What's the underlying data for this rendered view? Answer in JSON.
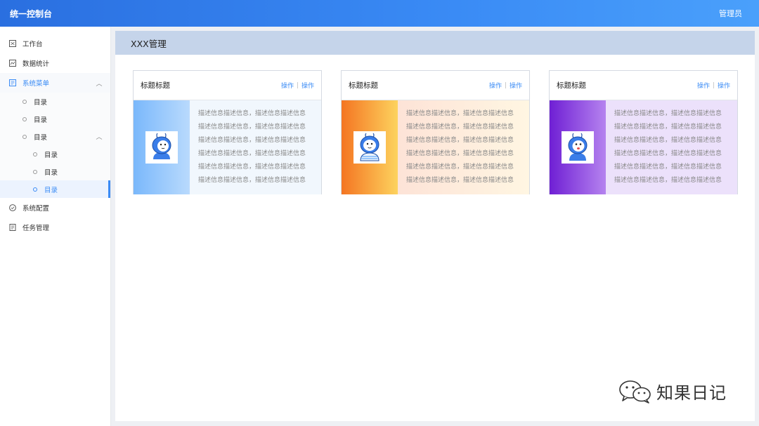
{
  "header": {
    "title": "统一控制台",
    "user": "管理员"
  },
  "sidebar": {
    "items": [
      {
        "label": "工作台",
        "icon": "workbench-icon"
      },
      {
        "label": "数据统计",
        "icon": "chart-icon"
      },
      {
        "label": "系统菜单",
        "icon": "menu-icon",
        "expanded": true,
        "children": [
          {
            "label": "目录"
          },
          {
            "label": "目录"
          },
          {
            "label": "目录",
            "expanded": true,
            "children": [
              {
                "label": "目录"
              },
              {
                "label": "目录"
              },
              {
                "label": "目录",
                "selected": true
              }
            ]
          }
        ]
      },
      {
        "label": "系统配置",
        "icon": "check-circle-icon"
      },
      {
        "label": "任务管理",
        "icon": "task-icon"
      }
    ]
  },
  "page": {
    "title": "XXX管理"
  },
  "cards": [
    {
      "title": "标题标题",
      "actions": [
        "操作",
        "操作"
      ],
      "description": [
        "描述信息描述信息，描述信息描述信息",
        "描述信息描述信息，描述信息描述信息",
        "描述信息描述信息，描述信息描述信息",
        "描述信息描述信息，描述信息描述信息",
        "描述信息描述信息，描述信息描述信息",
        "描述信息描述信息，描述信息描述信息"
      ],
      "accent": "#7ab8fb"
    },
    {
      "title": "标题标题",
      "actions": [
        "操作",
        "操作"
      ],
      "description": [
        "描述信息描述信息，描述信息描述信息",
        "描述信息描述信息，描述信息描述信息",
        "描述信息描述信息，描述信息描述信息",
        "描述信息描述信息，描述信息描述信息",
        "描述信息描述信息，描述信息描述信息",
        "描述信息描述信息，描述信息描述信息"
      ],
      "accent": "#f47522"
    },
    {
      "title": "标题标题",
      "actions": [
        "操作",
        "操作"
      ],
      "description": [
        "描述信息描述信息，描述信息描述信息",
        "描述信息描述信息，描述信息描述信息",
        "描述信息描述信息，描述信息描述信息",
        "描述信息描述信息，描述信息描述信息",
        "描述信息描述信息，描述信息描述信息",
        "描述信息描述信息，描述信息描述信息"
      ],
      "accent": "#6f1fd4"
    }
  ],
  "watermark": {
    "text": "知果日记",
    "icon": "wechat-icon"
  },
  "colors": {
    "primary": "#3a8bf5",
    "header_band": "#c5d4ea"
  }
}
